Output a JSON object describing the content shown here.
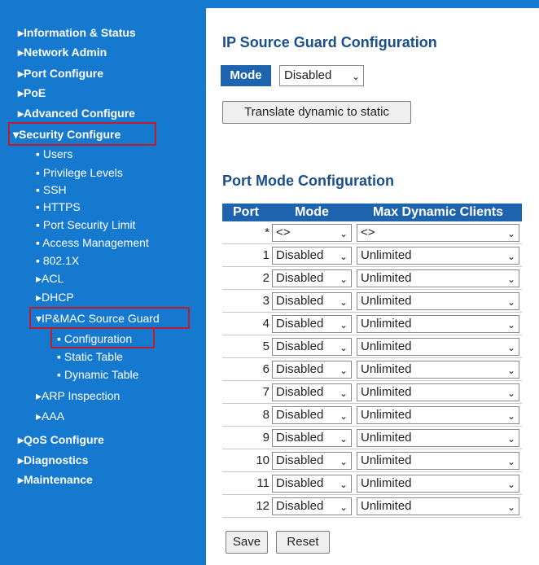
{
  "nav": {
    "top_items": [
      {
        "label": "▸Information & Status"
      },
      {
        "label": "▸Network Admin"
      },
      {
        "label": "▸Port Configure"
      },
      {
        "label": "▸PoE"
      },
      {
        "label": "▸Advanced Configure"
      },
      {
        "label": "▾Security Configure"
      }
    ],
    "security_items": [
      {
        "label": "▪ Users"
      },
      {
        "label": "▪ Privilege Levels"
      },
      {
        "label": "▪ SSH"
      },
      {
        "label": "▪ HTTPS"
      },
      {
        "label": "▪ Port Security Limit"
      },
      {
        "label": "▪ Access Management"
      },
      {
        "label": "▪ 802.1X"
      },
      {
        "label": "▸ACL"
      },
      {
        "label": "▸DHCP"
      },
      {
        "label": "▾IP&MAC Source Guard"
      },
      {
        "label": "▪ Configuration"
      },
      {
        "label": "▪ Static Table"
      },
      {
        "label": "▪ Dynamic Table"
      },
      {
        "label": "▸ARP Inspection"
      },
      {
        "label": "▸AAA"
      }
    ],
    "bottom_items": [
      {
        "label": "▸QoS Configure"
      },
      {
        "label": "▸Diagnostics"
      },
      {
        "label": "▸Maintenance"
      }
    ]
  },
  "main": {
    "title": "IP Source Guard Configuration",
    "mode_label": "Mode",
    "mode_value": "Disabled",
    "translate_button": "Translate dynamic to static",
    "port_mode_title": "Port Mode Configuration",
    "table": {
      "headers": [
        "Port",
        "Mode",
        "Max Dynamic Clients"
      ],
      "rows": [
        {
          "port": "*",
          "mode": "<>",
          "max": "<>"
        },
        {
          "port": "1",
          "mode": "Disabled",
          "max": "Unlimited"
        },
        {
          "port": "2",
          "mode": "Disabled",
          "max": "Unlimited"
        },
        {
          "port": "3",
          "mode": "Disabled",
          "max": "Unlimited"
        },
        {
          "port": "4",
          "mode": "Disabled",
          "max": "Unlimited"
        },
        {
          "port": "5",
          "mode": "Disabled",
          "max": "Unlimited"
        },
        {
          "port": "6",
          "mode": "Disabled",
          "max": "Unlimited"
        },
        {
          "port": "7",
          "mode": "Disabled",
          "max": "Unlimited"
        },
        {
          "port": "8",
          "mode": "Disabled",
          "max": "Unlimited"
        },
        {
          "port": "9",
          "mode": "Disabled",
          "max": "Unlimited"
        },
        {
          "port": "10",
          "mode": "Disabled",
          "max": "Unlimited"
        },
        {
          "port": "11",
          "mode": "Disabled",
          "max": "Unlimited"
        },
        {
          "port": "12",
          "mode": "Disabled",
          "max": "Unlimited"
        }
      ]
    },
    "save_button": "Save",
    "reset_button": "Reset"
  },
  "colors": {
    "sidebar_bg": "#1679d0",
    "header_bg": "#1e63ad",
    "highlight": "#c01d2c",
    "title": "#1a4f8a"
  },
  "icons": {
    "dropdown": "chevron-down-icon",
    "expand": "triangle-right-icon",
    "collapse": "triangle-down-icon",
    "bullet": "bullet-icon"
  }
}
